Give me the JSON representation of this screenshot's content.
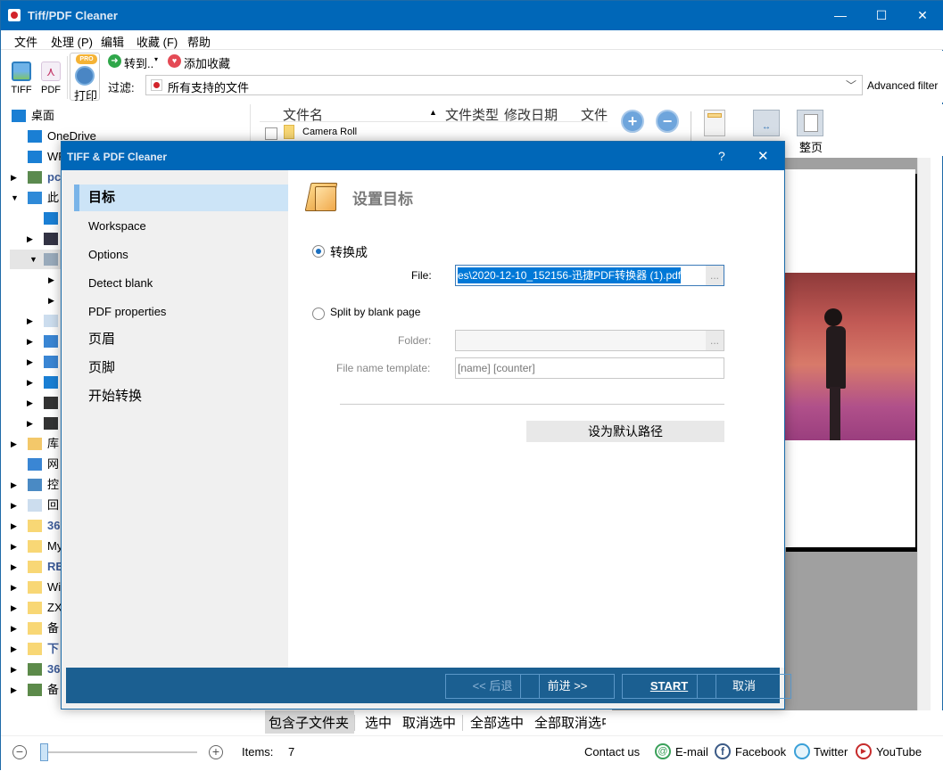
{
  "app": {
    "title": "Tiff/PDF Cleaner",
    "window_controls": {
      "minimize": "—",
      "maximize": "☐",
      "close": "✕"
    }
  },
  "menu": [
    "文件",
    "处理 (P)",
    "编辑",
    "收藏 (F)",
    "帮助"
  ],
  "toolbar": {
    "tiff_label": "TIFF",
    "pdf_label": "PDF",
    "print_label": "打印",
    "pro_badge": "PRO",
    "goto_label": "转到..",
    "favorite_label": "添加收藏",
    "filter_label": "过滤:",
    "filter_value": "所有支持的文件",
    "advanced_filter": "Advanced filter"
  },
  "tree": {
    "items": [
      {
        "label": "桌面",
        "icon": "desktop-icon",
        "arrow": ""
      },
      {
        "label": "OneDrive",
        "icon": "onedrive-icon",
        "arrow": ""
      },
      {
        "label": "WF",
        "icon": "cloud-icon",
        "arrow": ""
      },
      {
        "label": "pc",
        "icon": "user-icon",
        "arrow": "▶"
      },
      {
        "label": "此",
        "icon": "computer-icon",
        "arrow": "▼"
      },
      {
        "label": "",
        "icon": "cloud-icon",
        "arrow": ""
      },
      {
        "label": "",
        "icon": "video-icon",
        "arrow": "▶"
      },
      {
        "label": "",
        "icon": "pictures-icon",
        "arrow": "▼"
      },
      {
        "label": "",
        "icon": "",
        "arrow": "▶"
      },
      {
        "label": "",
        "icon": "",
        "arrow": "▶"
      },
      {
        "label": "",
        "icon": "document-icon",
        "arrow": "▶"
      },
      {
        "label": "",
        "icon": "download-icon",
        "arrow": "▶"
      },
      {
        "label": "",
        "icon": "music-icon",
        "arrow": "▶"
      },
      {
        "label": "",
        "icon": "desktop-icon",
        "arrow": "▶"
      },
      {
        "label": "",
        "icon": "drive-windows-icon",
        "arrow": "▶"
      },
      {
        "label": "",
        "icon": "drive-icon",
        "arrow": "▶"
      },
      {
        "label": "库",
        "icon": "library-icon",
        "arrow": "▶"
      },
      {
        "label": "网",
        "icon": "network-icon",
        "arrow": ""
      },
      {
        "label": "控",
        "icon": "control-panel-icon",
        "arrow": "▶"
      },
      {
        "label": "回",
        "icon": "recycle-bin-icon",
        "arrow": "▶"
      },
      {
        "label": "36",
        "icon": "folder-icon",
        "arrow": "▶"
      },
      {
        "label": "My",
        "icon": "folder-icon",
        "arrow": "▶"
      },
      {
        "label": "RE",
        "icon": "folder-icon",
        "arrow": "▶"
      },
      {
        "label": "Wi",
        "icon": "folder-icon",
        "arrow": "▶"
      },
      {
        "label": "ZX",
        "icon": "folder-icon",
        "arrow": "▶"
      },
      {
        "label": "备",
        "icon": "folder-icon",
        "arrow": "▶"
      },
      {
        "label": "下",
        "icon": "folder-icon",
        "arrow": "▶"
      },
      {
        "label": "36",
        "icon": "archive-icon",
        "arrow": "▶"
      },
      {
        "label": "备",
        "icon": "archive-icon",
        "arrow": "▶"
      }
    ]
  },
  "filelist": {
    "columns": [
      "文件名",
      "文件类型",
      "修改日期",
      "文件"
    ],
    "rows": [
      {
        "name": "Camera Roll",
        "type": "folder"
      }
    ]
  },
  "preview_tools": {
    "zoom_in": "放大",
    "zoom_out": "缩小",
    "page_tool1": "",
    "page_tool2": "",
    "full_page": "整页"
  },
  "bottom": {
    "include_subfolders": "包含子文件夹",
    "select": "选中",
    "deselect": "取消选中",
    "select_all": "全部选中",
    "deselect_all": "全部取消选中",
    "items_label": "Items:",
    "items_count": "7",
    "contact_us": "Contact us",
    "email": "E-mail",
    "facebook": "Facebook",
    "twitter": "Twitter",
    "youtube": "YouTube"
  },
  "dialog": {
    "title": "TIFF & PDF Cleaner",
    "help": "?",
    "close": "✕",
    "nav": [
      "目标",
      "Workspace",
      "Options",
      "Detect blank",
      "PDF properties",
      "页眉",
      "页脚",
      "开始转换"
    ],
    "section_title": "设置目标",
    "convert_to_label": "转换成",
    "file_label": "File:",
    "file_value": "es\\2020-12-10_152156-迅捷PDF转换器 (1).pdf",
    "browse": "...",
    "split_label": "Split by blank page",
    "folder_label": "Folder:",
    "folder_value": "",
    "template_label": "File name template:",
    "template_value": "[name] [counter]",
    "set_default": "设为默认路径",
    "back": "<< 后退",
    "next": "前进 >>",
    "start": "START",
    "cancel": "取消"
  }
}
